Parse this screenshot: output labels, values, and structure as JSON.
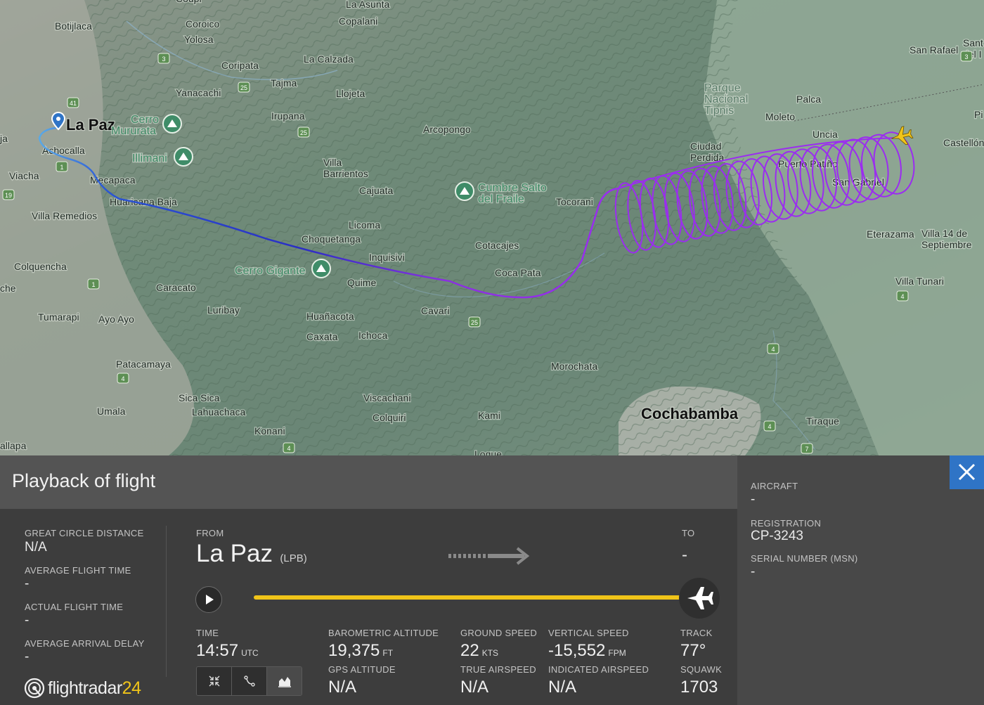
{
  "map": {
    "places": [
      {
        "name": "Botijlaca"
      },
      {
        "name": "Coroico"
      },
      {
        "name": "Yolosa"
      },
      {
        "name": "La Asunta"
      },
      {
        "name": "Copalani"
      },
      {
        "name": "La Calzada"
      },
      {
        "name": "Coripata"
      },
      {
        "name": "Tajma"
      },
      {
        "name": "Yanacachi"
      },
      {
        "name": "Llojeta"
      },
      {
        "name": "Irupana"
      },
      {
        "name": "La Paz"
      },
      {
        "name": "Cerro Mururata"
      },
      {
        "name": "Achocalla"
      },
      {
        "name": "Illimani"
      },
      {
        "name": "Viacha"
      },
      {
        "name": "Mecapaca"
      },
      {
        "name": "Huaricana Baja"
      },
      {
        "name": "Villa Remedios"
      },
      {
        "name": "Colquencha"
      },
      {
        "name": "Arcopongo"
      },
      {
        "name": "Villa Barrientos"
      },
      {
        "name": "Cajuata"
      },
      {
        "name": "Licoma"
      },
      {
        "name": "Choquetanga"
      },
      {
        "name": "Inquisivi"
      },
      {
        "name": "Cumbre Salto del Fraile"
      },
      {
        "name": "Tocorani"
      },
      {
        "name": "Cotacajes"
      },
      {
        "name": "Coca Pata"
      },
      {
        "name": "Cerro Gigante"
      },
      {
        "name": "Quime"
      },
      {
        "name": "Caracato"
      },
      {
        "name": "Luribay"
      },
      {
        "name": "Tumarapi"
      },
      {
        "name": "Ayo Ayo"
      },
      {
        "name": "Cavari"
      },
      {
        "name": "Huañacota"
      },
      {
        "name": "Caxata"
      },
      {
        "name": "Ichoca"
      },
      {
        "name": "Patacamaya"
      },
      {
        "name": "Morochata"
      },
      {
        "name": "Sica Sica"
      },
      {
        "name": "Lahuachaca"
      },
      {
        "name": "Viscachani"
      },
      {
        "name": "Colquiri"
      },
      {
        "name": "Kami"
      },
      {
        "name": "Cochabamba"
      },
      {
        "name": "Umala"
      },
      {
        "name": "Konani"
      },
      {
        "name": "Tiraque"
      },
      {
        "name": "Parque Nacional Tipnis"
      },
      {
        "name": "Palca"
      },
      {
        "name": "Moleto"
      },
      {
        "name": "Uncia"
      },
      {
        "name": "Ciudad Perdida"
      },
      {
        "name": "Puerto Patiño"
      },
      {
        "name": "San Gabriel"
      },
      {
        "name": "San Rafael"
      },
      {
        "name": "Santa Rosa del Ibare"
      },
      {
        "name": "Castellón"
      },
      {
        "name": "Eterazama"
      },
      {
        "name": "Villa 14 de Septiembre"
      },
      {
        "name": "Villa Tunari"
      },
      {
        "name": "allapa"
      },
      {
        "name": "che"
      },
      {
        "name": "ja"
      },
      {
        "name": "Pi"
      },
      {
        "name": "Coupi"
      },
      {
        "name": "Loque"
      }
    ]
  },
  "panel": {
    "title": "Playback of flight",
    "stats": {
      "great_circle_label": "GREAT CIRCLE DISTANCE",
      "great_circle_value": "N/A",
      "avg_flight_label": "AVERAGE FLIGHT TIME",
      "avg_flight_value": "-",
      "actual_flight_label": "ACTUAL FLIGHT TIME",
      "actual_flight_value": "-",
      "avg_delay_label": "AVERAGE ARRIVAL DELAY",
      "avg_delay_value": "-"
    },
    "route": {
      "from_label": "FROM",
      "from_city": "La Paz",
      "from_code": "(LPB)",
      "to_label": "TO",
      "to_value": "-"
    },
    "playback_progress": 1.0,
    "telemetry": {
      "time_label": "TIME",
      "time_value": "14:57",
      "time_unit": "UTC",
      "baro_label": "BAROMETRIC ALTITUDE",
      "baro_value": "19,375",
      "baro_unit": "FT",
      "gs_label": "GROUND SPEED",
      "gs_value": "22",
      "gs_unit": "KTS",
      "vs_label": "VERTICAL SPEED",
      "vs_value": "-15,552",
      "vs_unit": "FPM",
      "track_label": "TRACK",
      "track_value": "77°",
      "gps_label": "GPS ALTITUDE",
      "gps_value": "N/A",
      "tas_label": "TRUE AIRSPEED",
      "tas_value": "N/A",
      "ias_label": "INDICATED AIRSPEED",
      "ias_value": "N/A",
      "squawk_label": "SQUAWK",
      "squawk_value": "1703"
    },
    "aircraft": {
      "aircraft_label": "AIRCRAFT",
      "aircraft_value": "-",
      "reg_label": "REGISTRATION",
      "reg_value": "CP-3243",
      "msn_label": "SERIAL NUMBER (MSN)",
      "msn_value": "-"
    },
    "logo": {
      "text": "flightradar",
      "num": "24"
    }
  },
  "colors": {
    "track_start": "#5aa9e6",
    "track_mid": "#2a2ec4",
    "track_end": "#9b2cf0",
    "progress": "#f0c419",
    "close": "#2f74c6",
    "aircraft": "#f0c419"
  }
}
